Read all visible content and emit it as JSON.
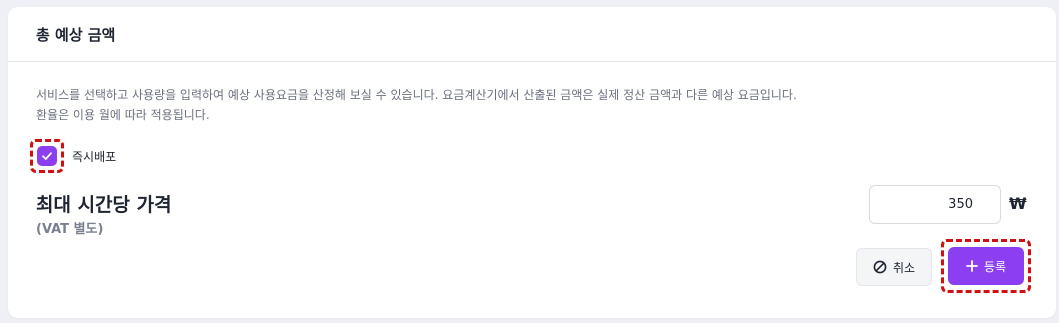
{
  "card": {
    "title": "총 예상 금액",
    "description_line1": "서비스를 선택하고 사용량을 입력하여 예상 사용요금을 산정해 보실 수 있습니다. 요금계산기에서 산출된 금액은 실제 정산 금액과 다른 예상 요금입니다.",
    "description_line2": "환율은 이용 월에 따라 적용됩니다."
  },
  "instant_deploy": {
    "label": "즉시배포",
    "checked": true
  },
  "price": {
    "title": "최대 시간당 가격",
    "subtitle": "(VAT 별도)",
    "value": "350",
    "currency": "₩"
  },
  "actions": {
    "cancel_label": "취소",
    "register_label": "등록"
  },
  "colors": {
    "accent": "#8b3ff0",
    "highlight_dash": "#d11111"
  },
  "icons": {
    "check": "check-icon",
    "cancel": "ban-icon",
    "register": "plus-icon"
  }
}
